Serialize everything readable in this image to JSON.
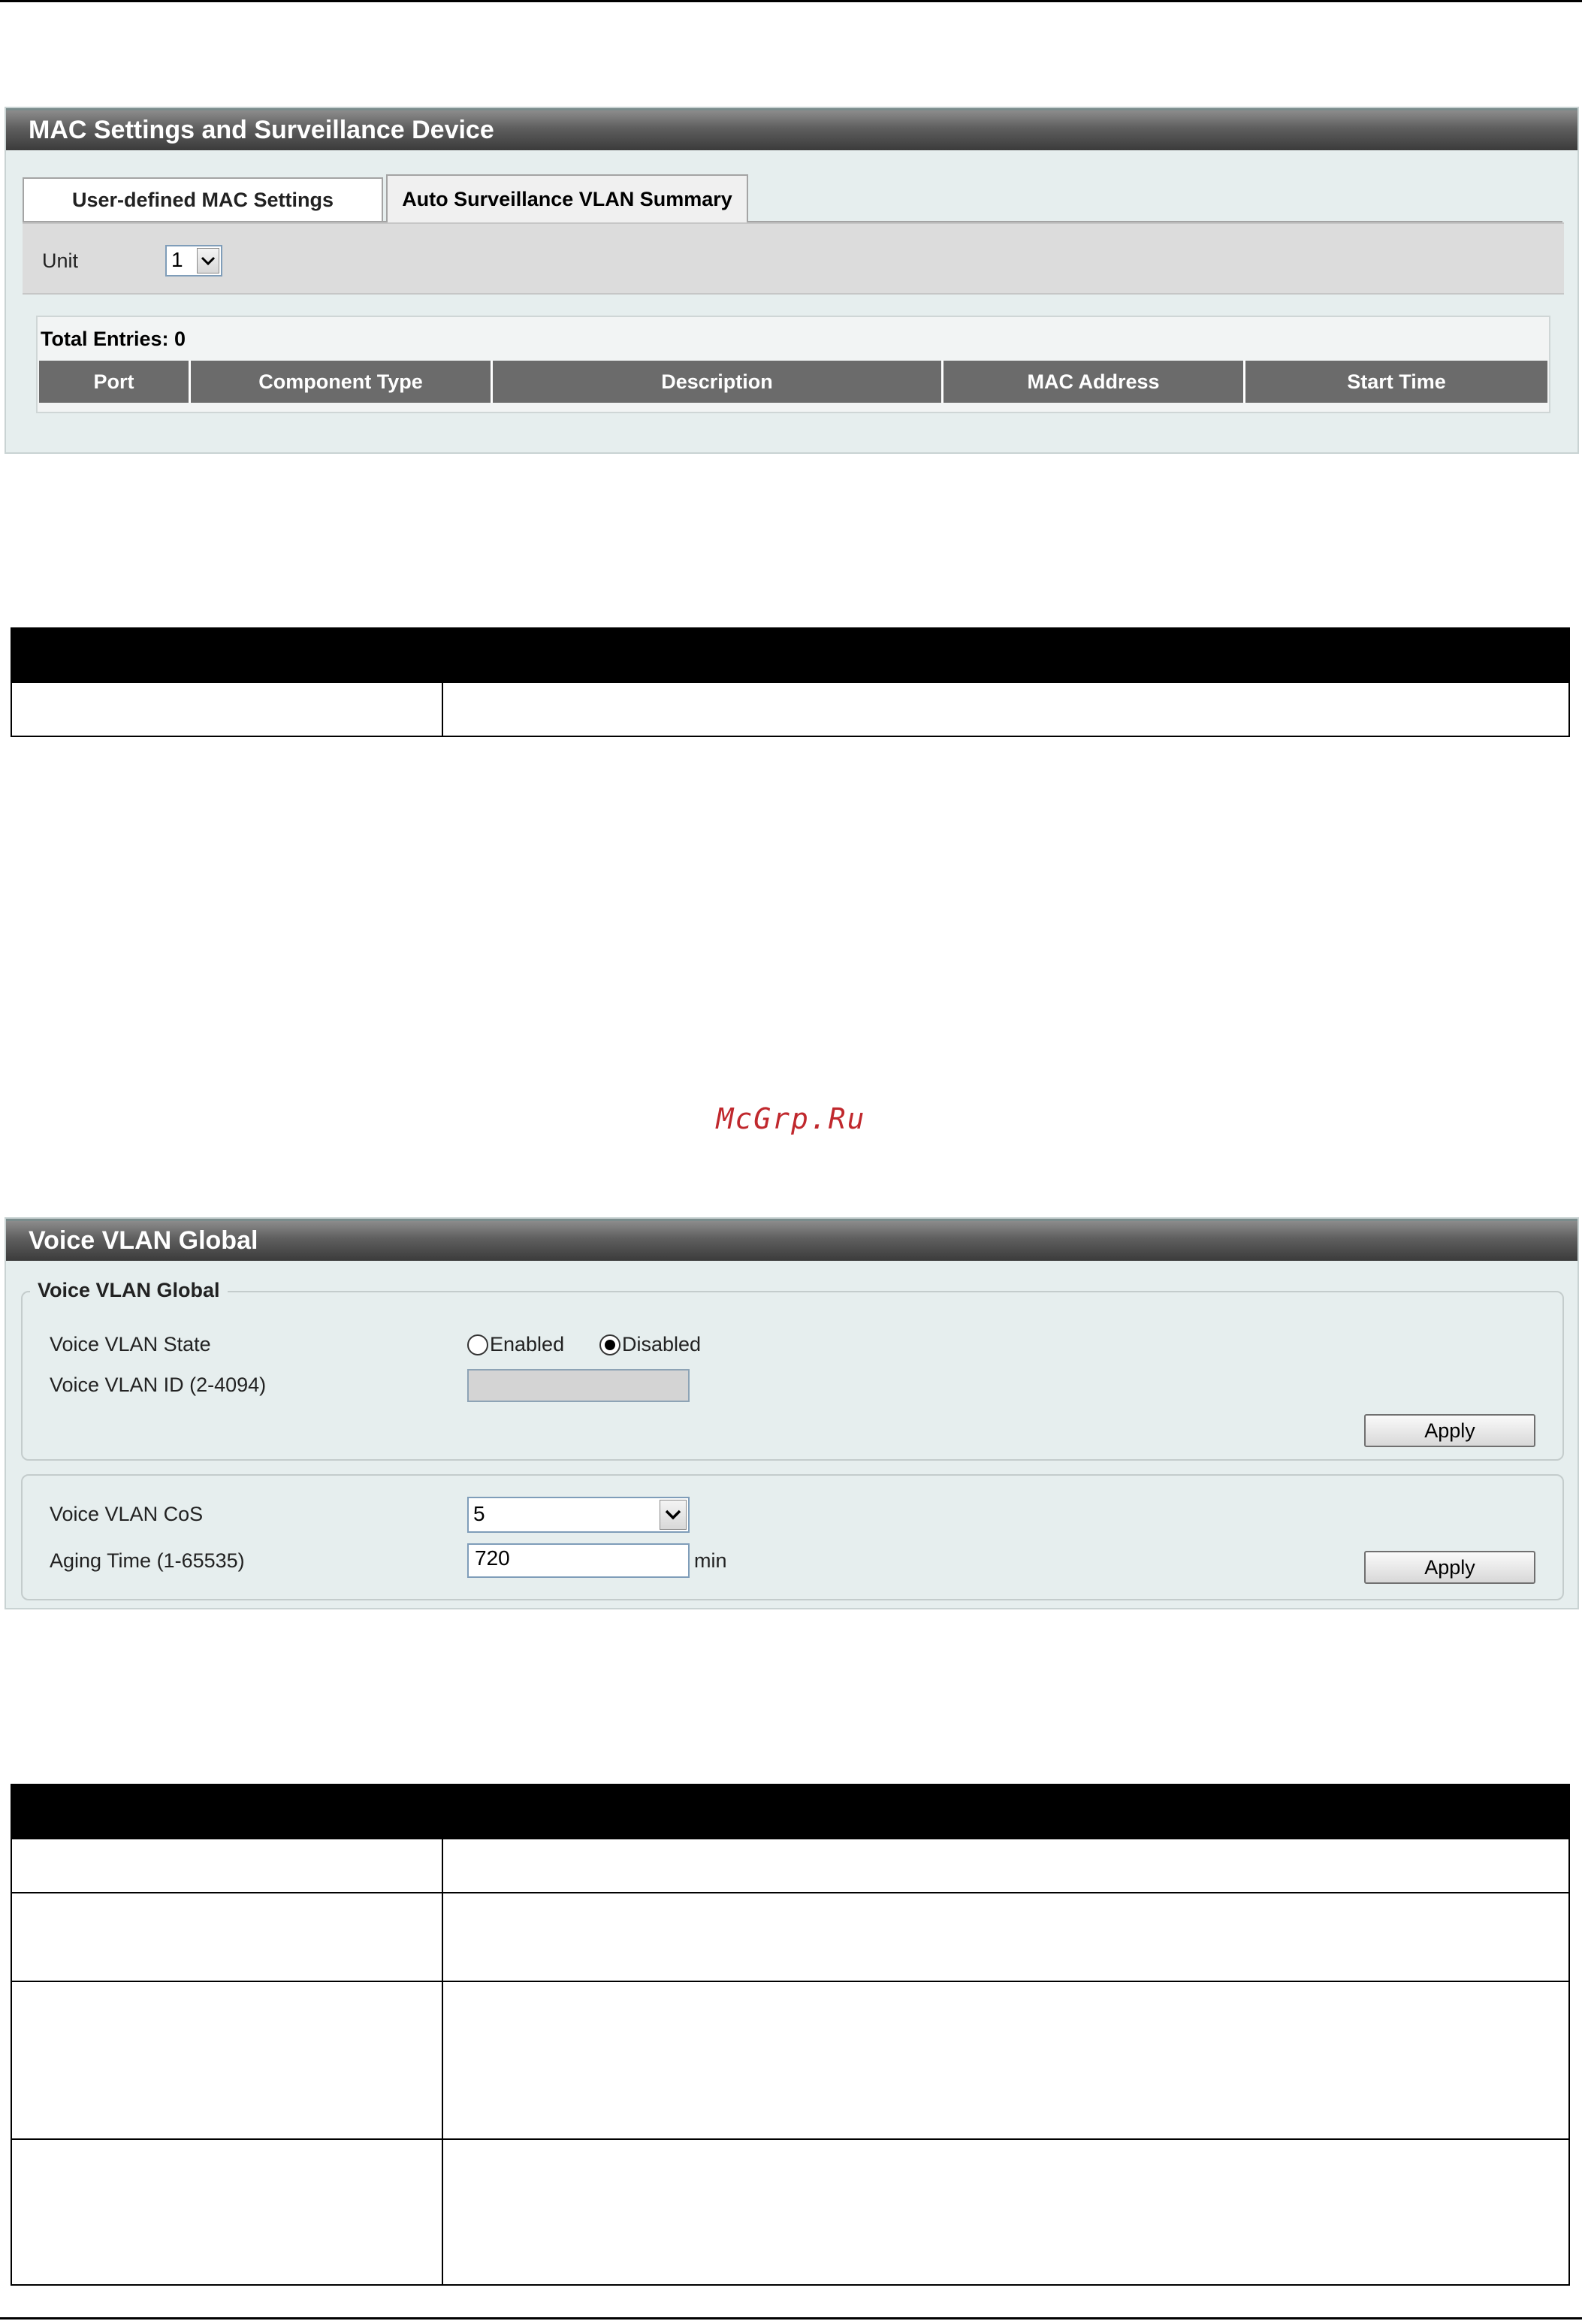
{
  "mac_panel": {
    "title": "MAC Settings and Surveillance Device",
    "tabs": [
      {
        "label": "User-defined MAC Settings",
        "active": false
      },
      {
        "label": "Auto Surveillance VLAN Summary",
        "active": true
      }
    ],
    "unit_label": "Unit",
    "unit_value": "1",
    "total_entries": "Total Entries: 0",
    "columns": [
      "Port",
      "Component Type",
      "Description",
      "MAC Address",
      "Start Time"
    ]
  },
  "watermark": "McGrp.Ru",
  "voice_panel": {
    "title": "Voice VLAN Global",
    "group_legend": "Voice VLAN Global",
    "state_label": "Voice VLAN State",
    "state_options": [
      "Enabled",
      "Disabled"
    ],
    "state_selected": "Disabled",
    "vlan_id_label": "Voice VLAN ID (2-4094)",
    "vlan_id_value": "",
    "apply_label": "Apply",
    "cos_label": "Voice VLAN CoS",
    "cos_value": "5",
    "aging_label": "Aging Time (1-65535)",
    "aging_value": "720",
    "aging_unit": "min"
  }
}
